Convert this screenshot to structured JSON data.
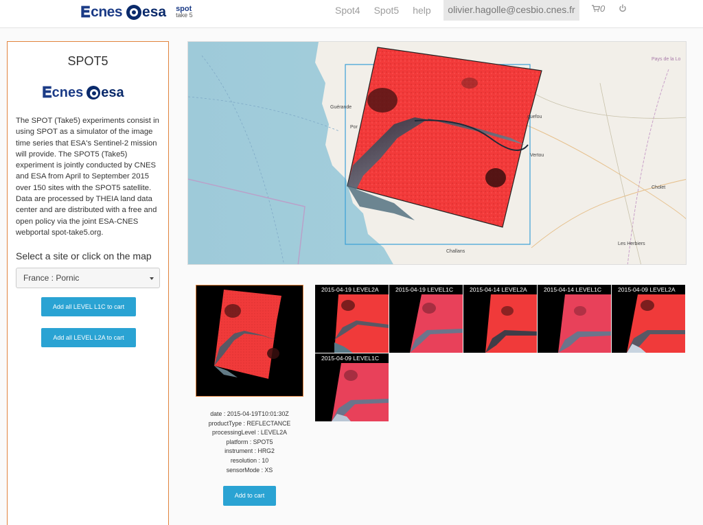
{
  "nav": {
    "brand_cnes": "cnes",
    "brand_esa": "esa",
    "brand_spot": "spot",
    "brand_take5": "take 5",
    "links": [
      "Spot4",
      "Spot5",
      "help"
    ],
    "user": "olivier.hagolle@cesbio.cnes.fr",
    "cart_count": "0",
    "icons": {
      "cart": "cart-icon",
      "power": "power-icon"
    }
  },
  "sidebar": {
    "title": "SPOT5",
    "logo_cnes": "cnes",
    "logo_esa": "esa",
    "description": "The SPOT (Take5) experiments consist in using SPOT as a simulator of the image time series that ESA's Sentinel-2 mission will provide. The SPOT5 (Take5) experiment is jointly conducted by CNES and ESA from April to September 2015 over 150 sites with the SPOT5 satellite. Data are processed by THEIA land data center and are distributed with a free and open policy via the joint ESA-CNES webportal spot-take5.org.",
    "select_label": "Select a site or click on the map",
    "selected_site": "France : Pornic",
    "btn_l1c": "Add all LEVEL L1C to cart",
    "btn_l2a": "Add all LEVEL L2A to cart"
  },
  "map": {
    "places": {
      "pays": "Pays de la Lo",
      "guerande": "Guérande",
      "pornic": "Por",
      "vertou": "Vertou",
      "cholet": "Cholet",
      "challans": "Challans",
      "herbiers": "Les Herbiers",
      "clisson": "quefou"
    },
    "colors": {
      "sea": "#aad3df",
      "land": "#f2efe9",
      "scene": "#f03a3a",
      "footprint": "#3a9fd6"
    }
  },
  "preview": {
    "meta": [
      "date : 2015-04-19T10:01:30Z",
      "productType : REFLECTANCE",
      "processingLevel : LEVEL2A",
      "platform : SPOT5",
      "instrument : HRG2",
      "resolution : 10",
      "sensorMode : XS"
    ],
    "add_to_cart": "Add to cart"
  },
  "scenes": {
    "items": [
      {
        "label": "2015-04-19 LEVEL2A"
      },
      {
        "label": "2015-04-19 LEVEL1C"
      },
      {
        "label": "2015-04-14 LEVEL2A"
      },
      {
        "label": "2015-04-14 LEVEL1C"
      },
      {
        "label": "2015-04-09 LEVEL2A"
      },
      {
        "label": "2015-04-09 LEVEL1C"
      }
    ]
  }
}
